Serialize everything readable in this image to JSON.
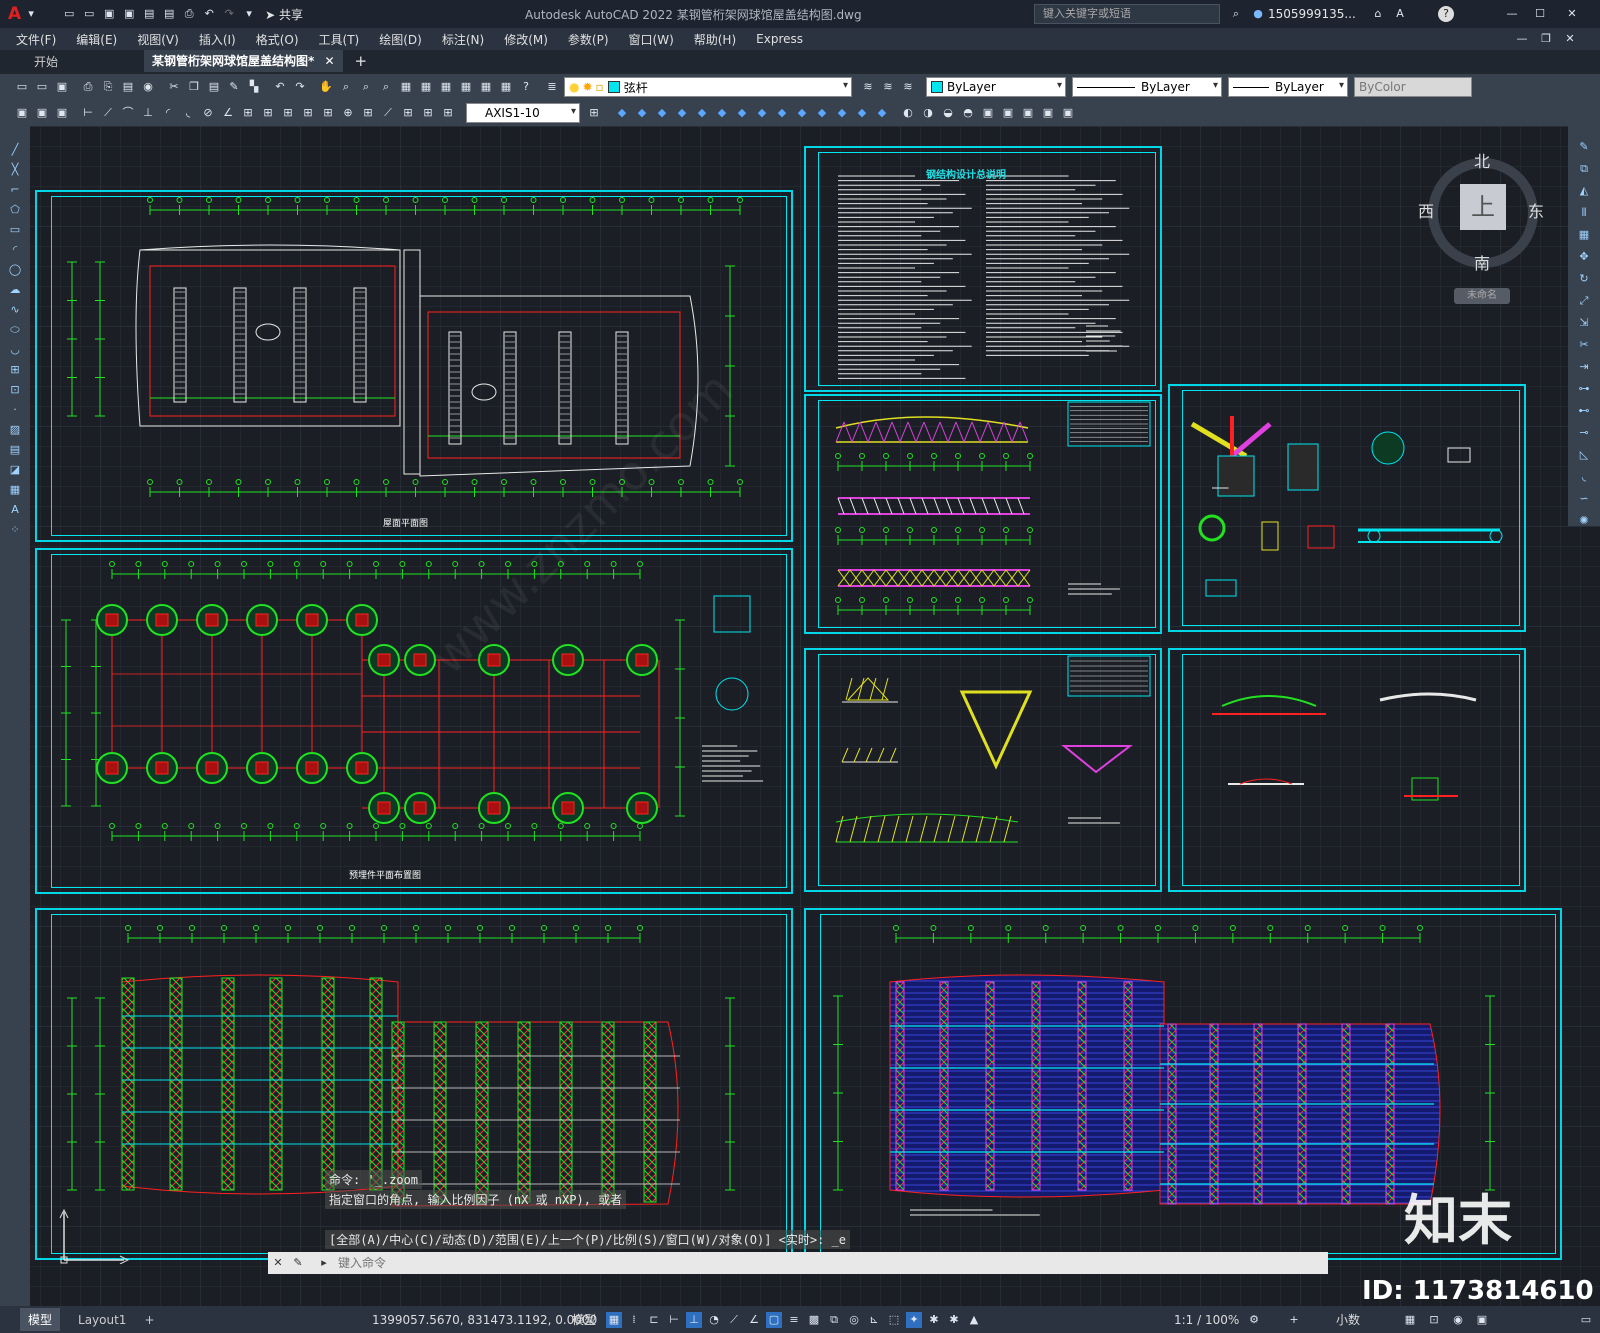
{
  "app": {
    "title": "Autodesk AutoCAD 2022    某钢管桁架网球馆屋盖结构图.dwg",
    "share_label": "共享",
    "search_placeholder": "键入关键字或短语",
    "user": "1505999135...",
    "logo_letter": "A"
  },
  "menu": [
    "文件(F)",
    "编辑(E)",
    "视图(V)",
    "插入(I)",
    "格式(O)",
    "工具(T)",
    "绘图(D)",
    "标注(N)",
    "修改(M)",
    "参数(P)",
    "窗口(W)",
    "帮助(H)",
    "Express"
  ],
  "tabs": {
    "start": "开始",
    "active": "某钢管桁架网球馆屋盖结构图*",
    "add": "+"
  },
  "toolbar": {
    "layer": "弦杆",
    "color": "ByLayer",
    "linetype": "ByLayer",
    "lineweight": "ByLayer",
    "plotstyle": "ByColor",
    "dimstyle": "AXIS1-10"
  },
  "viewcube": {
    "north": "北",
    "south": "南",
    "east": "东",
    "west": "西",
    "top": "上",
    "ucs": "未命名"
  },
  "sheets": {
    "s1_title": "屋面平面图",
    "s2_title": "预埋件平面布置图",
    "s3_title": "钢结构设计总说明",
    "s4_title": "",
    "s5_title": "",
    "s7_title": "",
    "s8_title": ""
  },
  "command": {
    "line1": "命令:  '_.zoom",
    "line2": "指定窗口的角点, 输入比例因子 (nX 或 nXP), 或者",
    "line3": "[全部(A)/中心(C)/动态(D)/范围(E)/上一个(P)/比例(S)/窗口(W)/对象(O)] <实时>: _e",
    "placeholder": "键入命令"
  },
  "watermark": {
    "logo": "知末",
    "id": "ID: 1173814610",
    "text": "www.znzmo.com"
  },
  "layout_tabs": {
    "model": "模型",
    "layout1": "Layout1"
  },
  "status": {
    "coords": "1399057.5670, 831473.1192, 0.0000",
    "mode": "模型",
    "scale": "1:1 / 100%",
    "units": "小数"
  },
  "colors": {
    "accent": "#00d7e6",
    "grid": "#2c333d",
    "green": "#22e022",
    "red": "#ff2020"
  }
}
